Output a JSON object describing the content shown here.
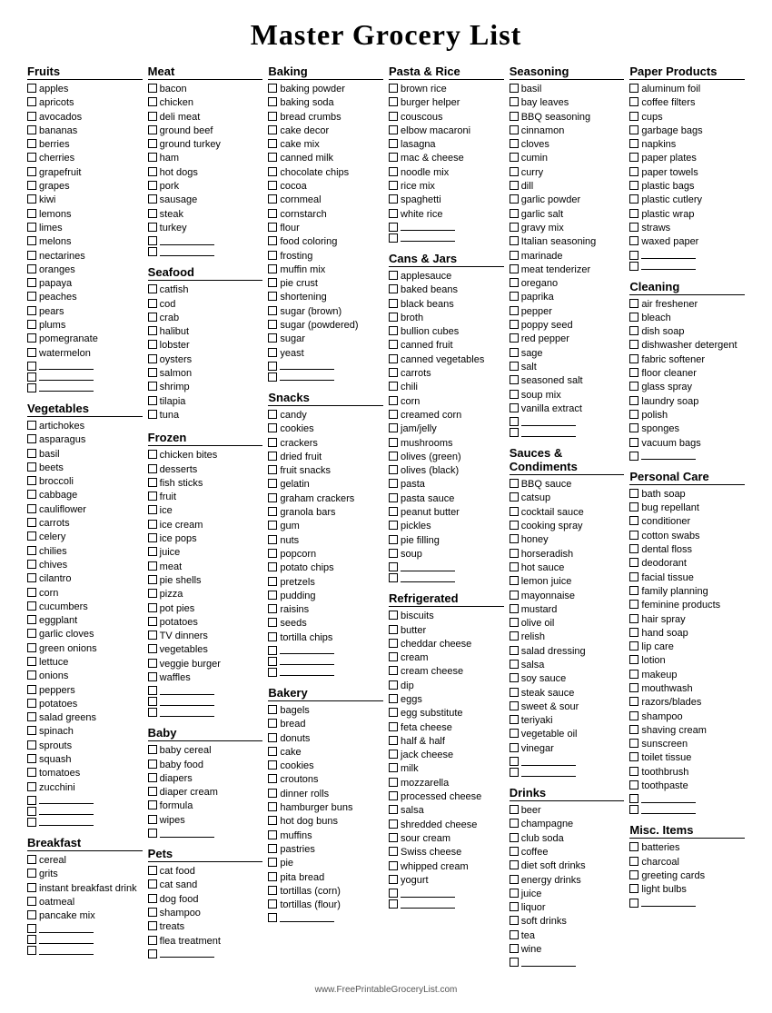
{
  "title": "Master Grocery List",
  "footer": "www.FreePrintableGroceryList.com",
  "columns": [
    {
      "sections": [
        {
          "title": "Fruits",
          "items": [
            "apples",
            "apricots",
            "avocados",
            "bananas",
            "berries",
            "cherries",
            "grapefruit",
            "grapes",
            "kiwi",
            "lemons",
            "limes",
            "melons",
            "nectarines",
            "oranges",
            "papaya",
            "peaches",
            "pears",
            "plums",
            "pomegranate",
            "watermelon"
          ],
          "blanks": 3
        },
        {
          "title": "Vegetables",
          "items": [
            "artichokes",
            "asparagus",
            "basil",
            "beets",
            "broccoli",
            "cabbage",
            "cauliflower",
            "carrots",
            "celery",
            "chilies",
            "chives",
            "cilantro",
            "corn",
            "cucumbers",
            "eggplant",
            "garlic cloves",
            "green onions",
            "lettuce",
            "onions",
            "peppers",
            "potatoes",
            "salad greens",
            "spinach",
            "sprouts",
            "squash",
            "tomatoes",
            "zucchini"
          ],
          "blanks": 3
        },
        {
          "title": "Breakfast",
          "items": [
            "cereal",
            "grits",
            "instant breakfast drink",
            "oatmeal",
            "pancake mix"
          ],
          "blanks": 3
        }
      ]
    },
    {
      "sections": [
        {
          "title": "Meat",
          "items": [
            "bacon",
            "chicken",
            "deli meat",
            "ground beef",
            "ground turkey",
            "ham",
            "hot dogs",
            "pork",
            "sausage",
            "steak",
            "turkey"
          ],
          "blanks": 2
        },
        {
          "title": "Seafood",
          "items": [
            "catfish",
            "cod",
            "crab",
            "halibut",
            "lobster",
            "oysters",
            "salmon",
            "shrimp",
            "tilapia",
            "tuna"
          ],
          "blanks": 0
        },
        {
          "title": "Frozen",
          "items": [
            "chicken bites",
            "desserts",
            "fish sticks",
            "fruit",
            "ice",
            "ice cream",
            "ice pops",
            "juice",
            "meat",
            "pie shells",
            "pizza",
            "pot pies",
            "potatoes",
            "TV dinners",
            "vegetables",
            "veggie burger",
            "waffles"
          ],
          "blanks": 3
        },
        {
          "title": "Baby",
          "items": [
            "baby cereal",
            "baby food",
            "diapers",
            "diaper cream",
            "formula",
            "wipes"
          ],
          "blanks": 1
        },
        {
          "title": "Pets",
          "items": [
            "cat food",
            "cat sand",
            "dog food",
            "shampoo",
            "treats",
            "flea treatment"
          ],
          "blanks": 1
        }
      ]
    },
    {
      "sections": [
        {
          "title": "Baking",
          "items": [
            "baking powder",
            "baking soda",
            "bread crumbs",
            "cake decor",
            "cake mix",
            "canned milk",
            "chocolate chips",
            "cocoa",
            "cornmeal",
            "cornstarch",
            "flour",
            "food coloring",
            "frosting",
            "muffin mix",
            "pie crust",
            "shortening",
            "sugar (brown)",
            "sugar (powdered)",
            "sugar",
            "yeast"
          ],
          "blanks": 2
        },
        {
          "title": "Snacks",
          "items": [
            "candy",
            "cookies",
            "crackers",
            "dried fruit",
            "fruit snacks",
            "gelatin",
            "graham crackers",
            "granola bars",
            "gum",
            "nuts",
            "popcorn",
            "potato chips",
            "pretzels",
            "pudding",
            "raisins",
            "seeds",
            "tortilla chips"
          ],
          "blanks": 3
        },
        {
          "title": "Bakery",
          "items": [
            "bagels",
            "bread",
            "donuts",
            "cake",
            "cookies",
            "croutons",
            "dinner rolls",
            "hamburger buns",
            "hot dog buns",
            "muffins",
            "pastries",
            "pie",
            "pita bread",
            "tortillas (corn)",
            "tortillas (flour)"
          ],
          "blanks": 1
        }
      ]
    },
    {
      "sections": [
        {
          "title": "Pasta & Rice",
          "items": [
            "brown rice",
            "burger helper",
            "couscous",
            "elbow macaroni",
            "lasagna",
            "mac & cheese",
            "noodle mix",
            "rice mix",
            "spaghetti",
            "white rice"
          ],
          "blanks": 2
        },
        {
          "title": "Cans & Jars",
          "items": [
            "applesauce",
            "baked beans",
            "black beans",
            "broth",
            "bullion cubes",
            "canned fruit",
            "canned vegetables",
            "carrots",
            "chili",
            "corn",
            "creamed corn",
            "jam/jelly",
            "mushrooms",
            "olives (green)",
            "olives (black)",
            "pasta",
            "pasta sauce",
            "peanut butter",
            "pickles",
            "pie filling",
            "soup"
          ],
          "blanks": 2
        },
        {
          "title": "Refrigerated",
          "items": [
            "biscuits",
            "butter",
            "cheddar cheese",
            "cream",
            "cream cheese",
            "dip",
            "eggs",
            "egg substitute",
            "feta cheese",
            "half & half",
            "jack cheese",
            "milk",
            "mozzarella",
            "processed cheese",
            "salsa",
            "shredded cheese",
            "sour cream",
            "Swiss cheese",
            "whipped cream",
            "yogurt"
          ],
          "blanks": 2
        }
      ]
    },
    {
      "sections": [
        {
          "title": "Seasoning",
          "items": [
            "basil",
            "bay leaves",
            "BBQ seasoning",
            "cinnamon",
            "cloves",
            "cumin",
            "curry",
            "dill",
            "garlic powder",
            "garlic salt",
            "gravy mix",
            "Italian seasoning",
            "marinade",
            "meat tenderizer",
            "oregano",
            "paprika",
            "pepper",
            "poppy seed",
            "red pepper",
            "sage",
            "salt",
            "seasoned salt",
            "soup mix",
            "vanilla extract"
          ],
          "blanks": 2
        },
        {
          "title": "Sauces & Condiments",
          "items": [
            "BBQ sauce",
            "catsup",
            "cocktail sauce",
            "cooking spray",
            "honey",
            "horseradish",
            "hot sauce",
            "lemon juice",
            "mayonnaise",
            "mustard",
            "olive oil",
            "relish",
            "salad dressing",
            "salsa",
            "soy sauce",
            "steak sauce",
            "sweet & sour",
            "teriyaki",
            "vegetable oil",
            "vinegar"
          ],
          "blanks": 2
        },
        {
          "title": "Drinks",
          "items": [
            "beer",
            "champagne",
            "club soda",
            "coffee",
            "diet soft drinks",
            "energy drinks",
            "juice",
            "liquor",
            "soft drinks",
            "tea",
            "wine"
          ],
          "blanks": 1
        }
      ]
    },
    {
      "sections": [
        {
          "title": "Paper Products",
          "items": [
            "aluminum foil",
            "coffee filters",
            "cups",
            "garbage bags",
            "napkins",
            "paper plates",
            "paper towels",
            "plastic bags",
            "plastic cutlery",
            "plastic wrap",
            "straws",
            "waxed paper"
          ],
          "blanks": 2
        },
        {
          "title": "Cleaning",
          "items": [
            "air freshener",
            "bleach",
            "dish soap",
            "dishwasher detergent",
            "fabric softener",
            "floor cleaner",
            "glass spray",
            "laundry soap",
            "polish",
            "sponges",
            "vacuum bags"
          ],
          "blanks": 1
        },
        {
          "title": "Personal Care",
          "items": [
            "bath soap",
            "bug repellant",
            "conditioner",
            "cotton swabs",
            "dental floss",
            "deodorant",
            "facial tissue",
            "family planning",
            "feminine products",
            "hair spray",
            "hand soap",
            "lip care",
            "lotion",
            "makeup",
            "mouthwash",
            "razors/blades",
            "shampoo",
            "shaving cream",
            "sunscreen",
            "toilet tissue",
            "toothbrush",
            "toothpaste"
          ],
          "blanks": 2
        },
        {
          "title": "Misc. Items",
          "items": [
            "batteries",
            "charcoal",
            "greeting cards",
            "light bulbs"
          ],
          "blanks": 1
        }
      ]
    }
  ]
}
